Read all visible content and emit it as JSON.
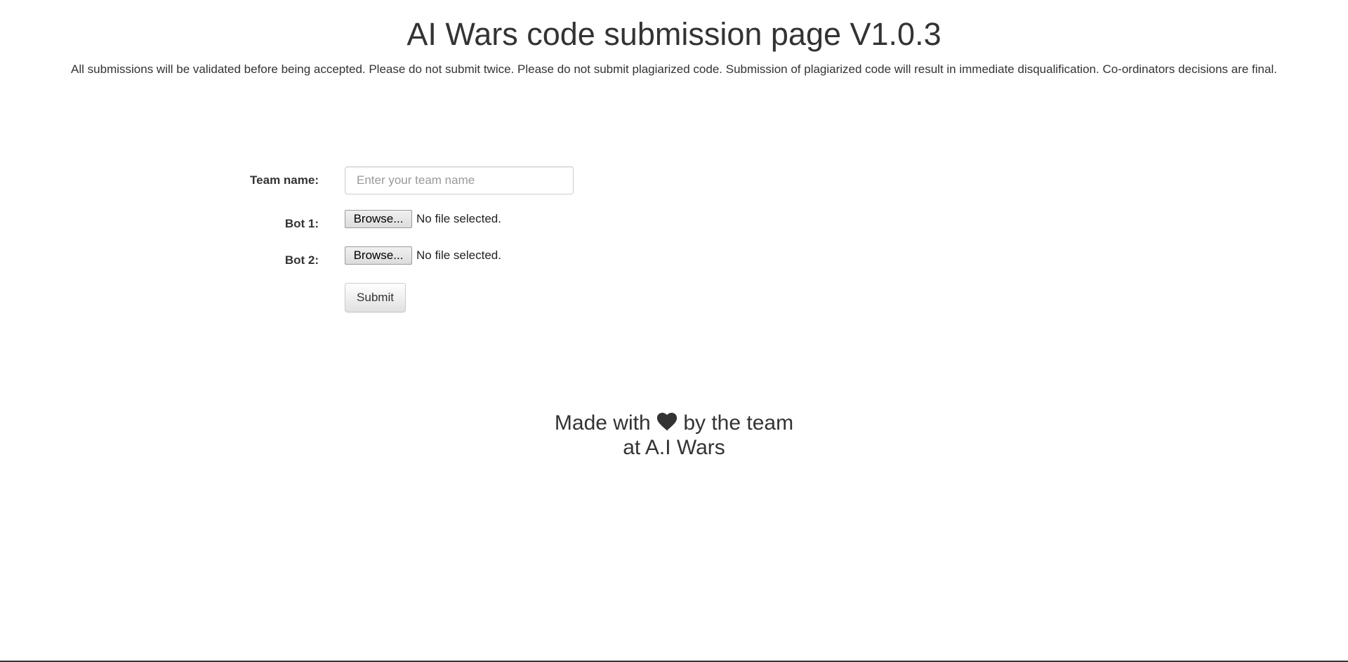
{
  "header": {
    "title": "AI Wars code submission page V1.0.3",
    "notice": "All submissions will be validated before being accepted. Please do not submit twice. Please do not submit plagiarized code. Submission of plagiarized code will result in immediate disqualification. Co-ordinators decisions are final."
  },
  "form": {
    "team_name": {
      "label": "Team name:",
      "placeholder": "Enter your team name",
      "value": ""
    },
    "bot1": {
      "label": "Bot 1:",
      "button_label": "Browse...",
      "status": "No file selected."
    },
    "bot2": {
      "label": "Bot 2:",
      "button_label": "Browse...",
      "status": "No file selected."
    },
    "submit_label": "Submit"
  },
  "footer": {
    "line1_prefix": "Made with",
    "heart_icon": "heart-icon",
    "line1_suffix": "by the team",
    "line2": "at A.I Wars"
  },
  "colors": {
    "text": "#333333",
    "placeholder": "#999999",
    "input_border": "#cccccc",
    "background": "#ffffff"
  }
}
